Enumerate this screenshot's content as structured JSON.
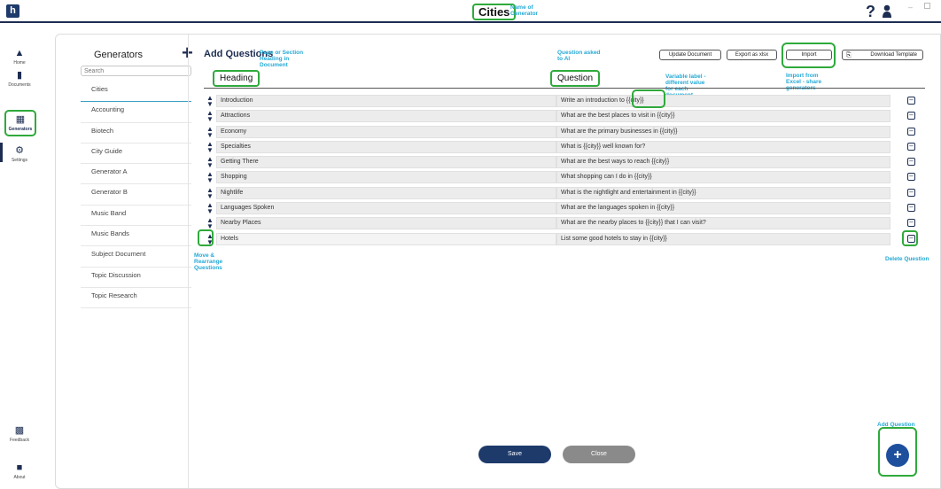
{
  "app": {
    "logo": "h",
    "title": "Cities",
    "title_note": "Name of Generator",
    "help_icon": "question-icon",
    "user_icon": "user-icon"
  },
  "nav": {
    "items": [
      {
        "label": "Home",
        "icon": "home-icon"
      },
      {
        "label": "Documents",
        "icon": "document-icon"
      },
      {
        "label": "Generators",
        "icon": "grid-icon"
      },
      {
        "label": "Settings",
        "icon": "gear-icon"
      },
      {
        "label": "Feedback",
        "icon": "feedback-icon"
      },
      {
        "label": "About",
        "icon": "about-icon"
      }
    ]
  },
  "generators": {
    "header": "Generators",
    "search_placeholder": "Search",
    "items": [
      "Cities",
      "Accounting",
      "Biotech",
      "City Guide",
      "Generator A",
      "Generator B",
      "Music Band",
      "Music Bands",
      "Subject Document",
      "Topic Discussion",
      "Topic Research"
    ]
  },
  "main": {
    "title": "Add Questions",
    "heading_label": "Heading",
    "question_label": "Question",
    "buttons": {
      "update": "Update Document",
      "export": "Export as xlsx",
      "import": "Import",
      "download": "Download Template"
    },
    "rows": [
      {
        "heading": "Introduction",
        "question": "Write an introduction to {{city}}"
      },
      {
        "heading": "Attractions",
        "question": "What are the best places to visit in {{city}}"
      },
      {
        "heading": "Economy",
        "question": "What are the primary businesses in {{city}}"
      },
      {
        "heading": "Specialties",
        "question": "What is {{city}} well known for?"
      },
      {
        "heading": "Getting There",
        "question": "What are the best ways to reach {{city}}"
      },
      {
        "heading": "Shopping",
        "question": "What shopping can I do in {{city}}"
      },
      {
        "heading": "Nightlife",
        "question": "What is the nightlight and entertainment in {{city}}"
      },
      {
        "heading": "Languages Spoken",
        "question": "What are the languages spoken in {{city}}"
      },
      {
        "heading": "Nearby Places",
        "question": "What are the nearby places to {{city}} that I can visit?"
      },
      {
        "heading": "Hotels",
        "question": "List some good hotels to stay in {{city}}"
      }
    ],
    "save_label": "Save",
    "close_label": "Close",
    "add_icon": "plus-icon"
  },
  "annotations": {
    "heading_note": "Page or Section Heading in Document",
    "question_note": "Question asked to AI",
    "variable_note": "Variable label - different value for each document",
    "import_note": "Import from Excel - share generators",
    "move_note": "Move & Rearrange Questions",
    "delete_note": "Delete Question",
    "add_note": "Add Question"
  },
  "colors": {
    "navy": "#1d2d52",
    "highlight": "#2faa3b",
    "annotation": "#24a9d6"
  }
}
